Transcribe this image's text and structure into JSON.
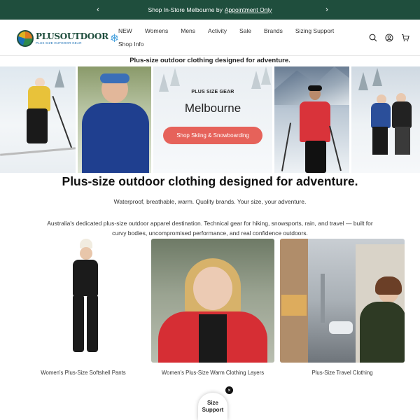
{
  "announcement": {
    "text": "Shop In-Store Melbourne by",
    "link": "Appointment Only",
    "prev_icon": "chevron-left-icon",
    "next_icon": "chevron-right-icon"
  },
  "header": {
    "logo_text": "PLUSOUTDOOR",
    "logo_tagline": "PLUS SIZE OUTDOOR GEAR",
    "nav": [
      "NEW",
      "Womens",
      "Mens",
      "Activity",
      "Sale",
      "Brands",
      "Sizing Support",
      "Shop Info"
    ],
    "icons": [
      "search-icon",
      "account-icon",
      "cart-icon"
    ]
  },
  "tagline_top": "Plus-size outdoor clothing designed for adventure.",
  "hero": {
    "kicker": "PLUS SIZE GEAR",
    "city": "Melbourne",
    "cta": "Shop Skiing & Snowboarding"
  },
  "headline": "Plus-size outdoor clothing designed for adventure.",
  "subhead": "Waterproof, breathable, warm. Quality brands. Your size, your adventure.",
  "paragraph": "Australia's dedicated plus-size outdoor apparel destination. Technical gear for hiking, snowsports, rain, and travel — built for curvy bodies, uncompromised performance, and real confidence outdoors.",
  "products": [
    {
      "caption": "Women's Plus-Size Softshell Pants"
    },
    {
      "caption": "Women's Plus-Size Warm Clothing Layers"
    },
    {
      "caption": "Plus-Size Travel Clothing"
    }
  ],
  "size_support": {
    "label": "Size Support",
    "close": "×"
  },
  "colors": {
    "brand": "#1f4e3d",
    "cta": "#e6625a"
  }
}
